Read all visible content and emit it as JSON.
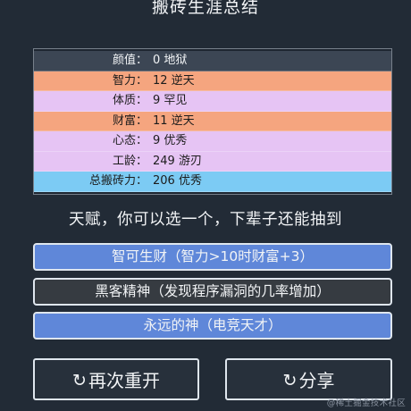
{
  "title": "搬砖生涯总结",
  "stats": [
    {
      "label": "颜值",
      "value": "0 地狱",
      "tone": "dark"
    },
    {
      "label": "智力",
      "value": "12 逆天",
      "tone": "orange"
    },
    {
      "label": "体质",
      "value": "9 罕见",
      "tone": "purple"
    },
    {
      "label": "财富",
      "value": "11 逆天",
      "tone": "orange"
    },
    {
      "label": "心态",
      "value": "9 优秀",
      "tone": "purple"
    },
    {
      "label": "工龄",
      "value": "249 游刃",
      "tone": "purple"
    },
    {
      "label": "总搬砖力",
      "value": "206 优秀",
      "tone": "blue"
    }
  ],
  "stat_separator": "：",
  "prompt": "天赋，你可以选一个，下辈子还能抽到",
  "talents": [
    {
      "text": "智可生财（智力>10时财富+3）",
      "selected": true
    },
    {
      "text": "黑客精神（发现程序漏洞的几率增加）",
      "selected": false
    },
    {
      "text": "永远的神（电竞天才）",
      "selected": true
    }
  ],
  "buttons": {
    "restart_label": "再次重开",
    "share_label": "分享",
    "restart_icon": "refresh-icon",
    "share_icon": "refresh-icon"
  },
  "watermark": "@稀土掘金技术社区",
  "colors": {
    "background": "#222b36",
    "row_dark": "#3c4654",
    "row_orange": "#f5a57f",
    "row_purple": "#e6c4f4",
    "row_blue": "#7ccbf4",
    "talent_selected": "#5f87d9",
    "talent_unselected": "#363b41"
  }
}
